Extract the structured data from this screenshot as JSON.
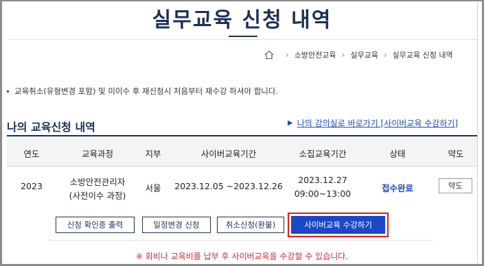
{
  "page": {
    "title": "실무교육 신청 내역"
  },
  "breadcrumb": {
    "items": [
      "소방안전교육",
      "실무교육",
      "실무교육 신청 내역"
    ]
  },
  "notice": {
    "text": "교육취소(유형변경 포함) 및 미이수 후 재신청시 처음부터 재수강 하셔야 합니다."
  },
  "section": {
    "title": "나의 교육신청 내역",
    "link_text": "나의 강의실로 바로가기 [사이버교육 수강하기]"
  },
  "table": {
    "headers": [
      "연도",
      "교육과정",
      "지부",
      "사이버교육기간",
      "소집교육기간",
      "상태",
      "약도"
    ],
    "rows": [
      {
        "year": "2023",
        "course_line1": "소방안전관리자",
        "course_line2": "(사전이수 과정)",
        "branch": "서울",
        "cyber_period": "2023.12.05 ~2023.12.26",
        "convene_date": "2023.12.27",
        "convene_time": "09:00~13:00",
        "status": "접수완료",
        "map_button": "약도"
      }
    ]
  },
  "actions": {
    "print_certificate": "신청 확인증 출력",
    "change_schedule": "일정변경 신청",
    "cancel_refund": "취소신청(환불)",
    "start_cyber": "사이버교육 수강하기"
  },
  "footer": {
    "note": "※ 회비나 교육비를 납부 후 사이버교육을 수강할 수 있습니다."
  },
  "colors": {
    "title": "#1c2f57",
    "link": "#1a4ab8",
    "primary_button": "#1a48c8",
    "highlight": "#e21b1b",
    "footer_note": "#d4293a"
  },
  "icons": {
    "home": "home-icon",
    "breadcrumb_separator": "chevron-right-icon",
    "link_arrow": "triangle-right-icon"
  }
}
